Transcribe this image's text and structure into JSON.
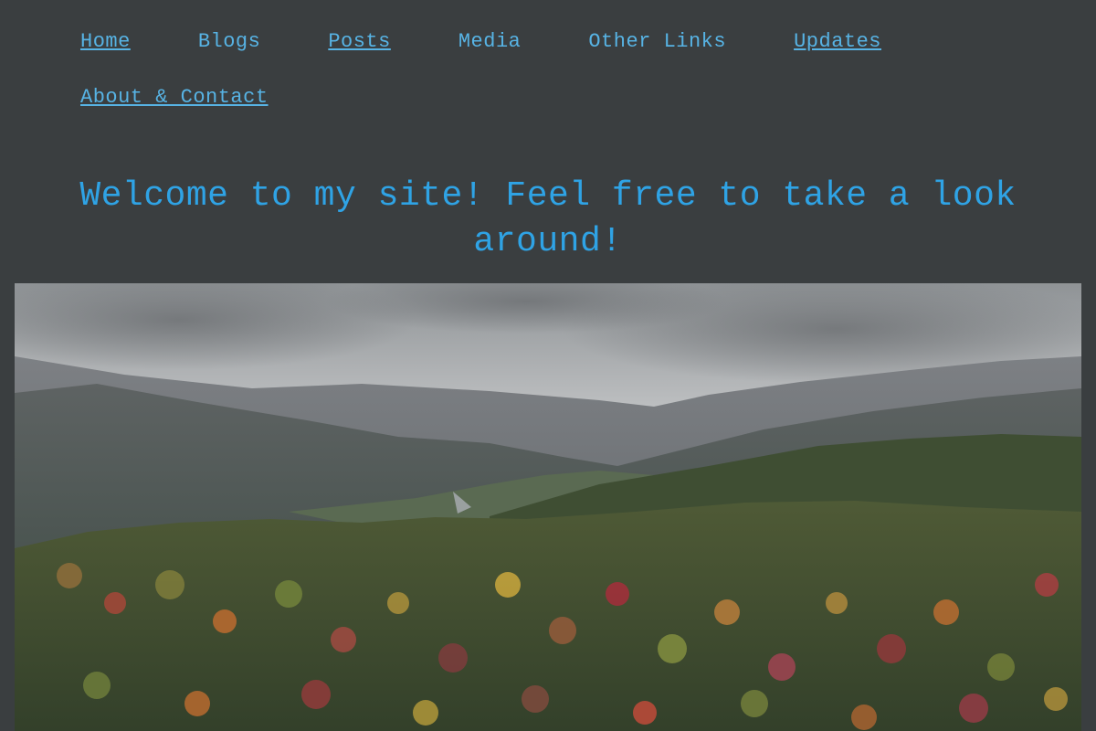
{
  "nav": {
    "row1": [
      {
        "label": "Home",
        "underlined": true
      },
      {
        "label": "Blogs",
        "underlined": false
      },
      {
        "label": "Posts",
        "underlined": true
      },
      {
        "label": "Media",
        "underlined": false
      },
      {
        "label": "Other Links",
        "underlined": false
      },
      {
        "label": "Updates",
        "underlined": true
      }
    ],
    "row2": [
      {
        "label": "About & Contact",
        "underlined": true
      }
    ]
  },
  "welcome": {
    "title": "Welcome to my site! Feel free to take a look around!"
  },
  "colors": {
    "background": "#3a3e40",
    "link": "#57b3e4",
    "heading": "#2fa3e5"
  },
  "hero": {
    "icon": "landscape-photo"
  }
}
